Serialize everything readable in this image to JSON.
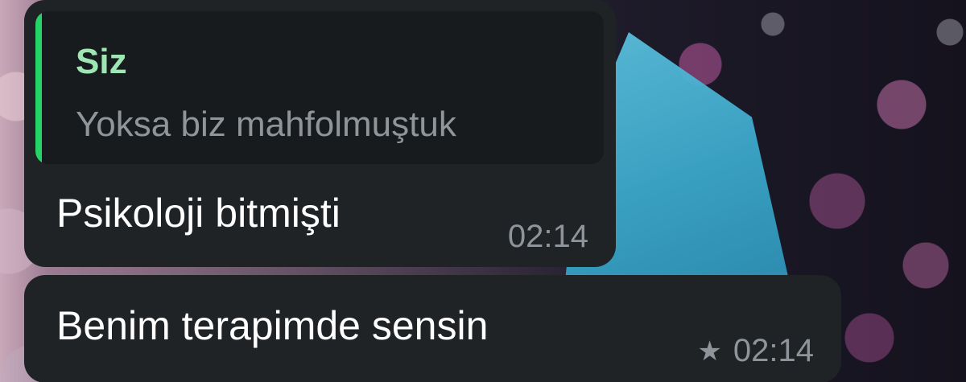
{
  "chat": {
    "messages": [
      {
        "quote": {
          "author": "Siz",
          "text": "Yoksa biz mahfolmuştuk"
        },
        "text": "Psikoloji bitmişti",
        "time": "02:14"
      },
      {
        "text": "Benim terapimde sensin",
        "time": "02:14",
        "starred": true,
        "star_icon": "star-icon"
      }
    ]
  },
  "colors": {
    "bubble": "#1f2326",
    "quote_bar": "#25d366",
    "quote_author": "#9ee6b4",
    "meta": "#8e9499"
  }
}
